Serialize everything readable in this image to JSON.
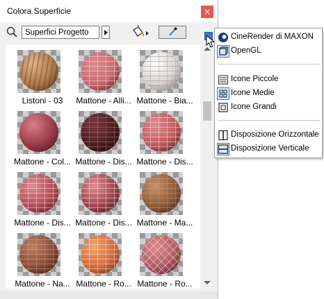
{
  "window": {
    "title": "Colora Superficie",
    "close": "×"
  },
  "toolbar": {
    "search_value": "Superfici Progetto"
  },
  "materials": [
    {
      "label": "Listoni - 03",
      "color": "#b07a4e",
      "pattern": "wood"
    },
    {
      "label": "Mattone - Alli...",
      "color": "#c86a6f",
      "pattern": "brick-light"
    },
    {
      "label": "Mattone - Bia...",
      "color": "#d8d3d0",
      "pattern": "brick-white"
    },
    {
      "label": "Mattone - Col...",
      "color": "#9a3a46",
      "pattern": "plain"
    },
    {
      "label": "Mattone - Dis...",
      "color": "#4a1d22",
      "pattern": "brick-dark"
    },
    {
      "label": "Mattone - Dis...",
      "color": "#c25a5f",
      "pattern": "brick-light"
    },
    {
      "label": "Mattone - Dis...",
      "color": "#b34c55",
      "pattern": "brick"
    },
    {
      "label": "Mattone - Dis...",
      "color": "#a04450",
      "pattern": "brick"
    },
    {
      "label": "Mattone - Ma...",
      "color": "#8e5a3a",
      "pattern": "brick-brown"
    },
    {
      "label": "Mattone - Na...",
      "color": "#8a4a36",
      "pattern": "brick-mixed"
    },
    {
      "label": "Mattone - Ro...",
      "color": "#d06a3a",
      "pattern": "brick-orange"
    },
    {
      "label": "Mattone - Ro...",
      "color": "#b05a60",
      "pattern": "herringbone"
    }
  ],
  "menu": {
    "items": [
      {
        "label": "CineRender di MAXON",
        "icon": "cinerender-icon"
      },
      {
        "label": "OpenGL",
        "icon": "opengl-icon"
      },
      {
        "label": "Icone Piccole",
        "icon": "list-small-icon"
      },
      {
        "label": "Icone Medie",
        "icon": "grid-medium-icon"
      },
      {
        "label": "Icone Grandi",
        "icon": "square-large-icon"
      },
      {
        "label": "Disposizione Orizzontale",
        "icon": "horizontal-layout-icon"
      },
      {
        "label": "Disposizione Verticale",
        "icon": "vertical-layout-icon"
      }
    ]
  }
}
